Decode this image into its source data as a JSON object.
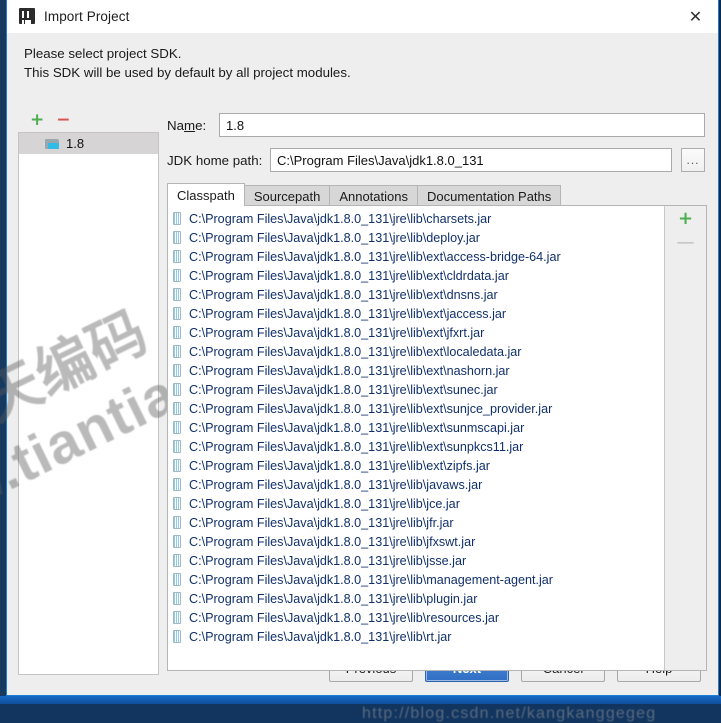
{
  "window": {
    "title": "Import Project",
    "app_icon": "intellij-idea-icon",
    "close_icon": "close-icon",
    "border_color": "#1a7fd4"
  },
  "prompt": {
    "line1": "Please select project SDK.",
    "line2": "This SDK will be used by default by all project modules."
  },
  "sdk_panel": {
    "add_label": "+",
    "remove_label": "−",
    "items": [
      {
        "label": "1.8",
        "icon": "folder-icon",
        "selected": true
      }
    ]
  },
  "detail": {
    "name_label_pre": "Na",
    "name_label_mnemonic": "m",
    "name_label_post": "e:",
    "name_value": "1.8",
    "jdk_label": "JDK home path:",
    "jdk_value": "C:\\Program Files\\Java\\jdk1.8.0_131",
    "browse_label": "..."
  },
  "tabs": [
    {
      "label": "Classpath",
      "active": true
    },
    {
      "label": "Sourcepath",
      "active": false
    },
    {
      "label": "Annotations",
      "active": false
    },
    {
      "label": "Documentation Paths",
      "active": false
    }
  ],
  "classpath": {
    "add_label": "+",
    "remove_label": "—",
    "entries": [
      "C:\\Program Files\\Java\\jdk1.8.0_131\\jre\\lib\\charsets.jar",
      "C:\\Program Files\\Java\\jdk1.8.0_131\\jre\\lib\\deploy.jar",
      "C:\\Program Files\\Java\\jdk1.8.0_131\\jre\\lib\\ext\\access-bridge-64.jar",
      "C:\\Program Files\\Java\\jdk1.8.0_131\\jre\\lib\\ext\\cldrdata.jar",
      "C:\\Program Files\\Java\\jdk1.8.0_131\\jre\\lib\\ext\\dnsns.jar",
      "C:\\Program Files\\Java\\jdk1.8.0_131\\jre\\lib\\ext\\jaccess.jar",
      "C:\\Program Files\\Java\\jdk1.8.0_131\\jre\\lib\\ext\\jfxrt.jar",
      "C:\\Program Files\\Java\\jdk1.8.0_131\\jre\\lib\\ext\\localedata.jar",
      "C:\\Program Files\\Java\\jdk1.8.0_131\\jre\\lib\\ext\\nashorn.jar",
      "C:\\Program Files\\Java\\jdk1.8.0_131\\jre\\lib\\ext\\sunec.jar",
      "C:\\Program Files\\Java\\jdk1.8.0_131\\jre\\lib\\ext\\sunjce_provider.jar",
      "C:\\Program Files\\Java\\jdk1.8.0_131\\jre\\lib\\ext\\sunmscapi.jar",
      "C:\\Program Files\\Java\\jdk1.8.0_131\\jre\\lib\\ext\\sunpkcs11.jar",
      "C:\\Program Files\\Java\\jdk1.8.0_131\\jre\\lib\\ext\\zipfs.jar",
      "C:\\Program Files\\Java\\jdk1.8.0_131\\jre\\lib\\javaws.jar",
      "C:\\Program Files\\Java\\jdk1.8.0_131\\jre\\lib\\jce.jar",
      "C:\\Program Files\\Java\\jdk1.8.0_131\\jre\\lib\\jfr.jar",
      "C:\\Program Files\\Java\\jdk1.8.0_131\\jre\\lib\\jfxswt.jar",
      "C:\\Program Files\\Java\\jdk1.8.0_131\\jre\\lib\\jsse.jar",
      "C:\\Program Files\\Java\\jdk1.8.0_131\\jre\\lib\\management-agent.jar",
      "C:\\Program Files\\Java\\jdk1.8.0_131\\jre\\lib\\plugin.jar",
      "C:\\Program Files\\Java\\jdk1.8.0_131\\jre\\lib\\resources.jar",
      "C:\\Program Files\\Java\\jdk1.8.0_131\\jre\\lib\\rt.jar"
    ]
  },
  "buttons": [
    {
      "label": "Previous",
      "primary": false
    },
    {
      "label": "Next",
      "primary": true
    },
    {
      "label": "Cancel",
      "primary": false
    },
    {
      "label": "Help",
      "primary": false
    }
  ],
  "watermarks": {
    "diagonal_line1": "天编码",
    "diagonal_line2": "w.tiantianbianma.com",
    "bottom": "http://blog.csdn.net/kangkanggegeg"
  }
}
